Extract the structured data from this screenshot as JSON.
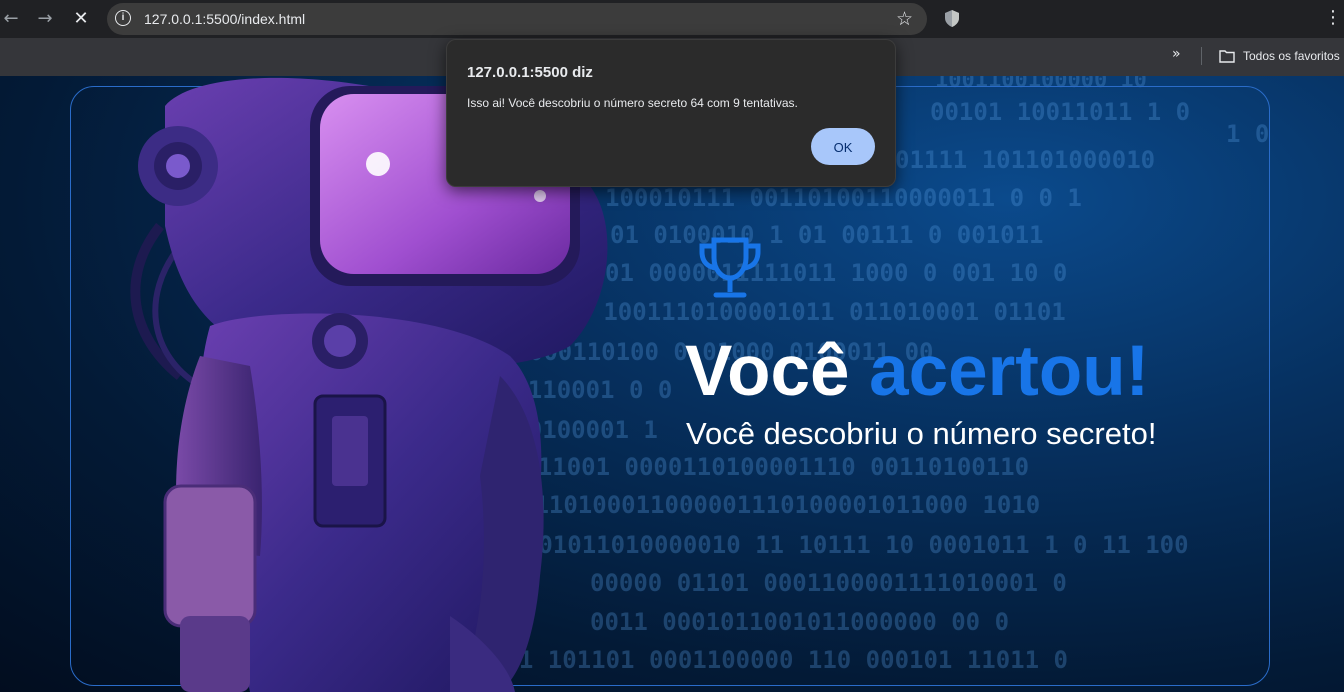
{
  "browser": {
    "url": "127.0.0.1:5500/index.html",
    "bookmarks_folder": "Todos os favoritos"
  },
  "page": {
    "title_part1": "Você",
    "title_part2": "acertou!",
    "subtitle": "Você descobriu o número secreto!",
    "accent_color": "#1875e8"
  },
  "dialog": {
    "title": "127.0.0.1:5500 diz",
    "message": "Isso ai! Você descobriu o número secreto 64 com 9 tentativas.",
    "ok_label": "OK"
  },
  "icons": [
    "back-icon",
    "forward-icon",
    "stop-icon",
    "info-icon",
    "star-icon",
    "shield-icon",
    "menu-icon",
    "chevron-icon",
    "folder-icon",
    "trophy-icon"
  ]
}
